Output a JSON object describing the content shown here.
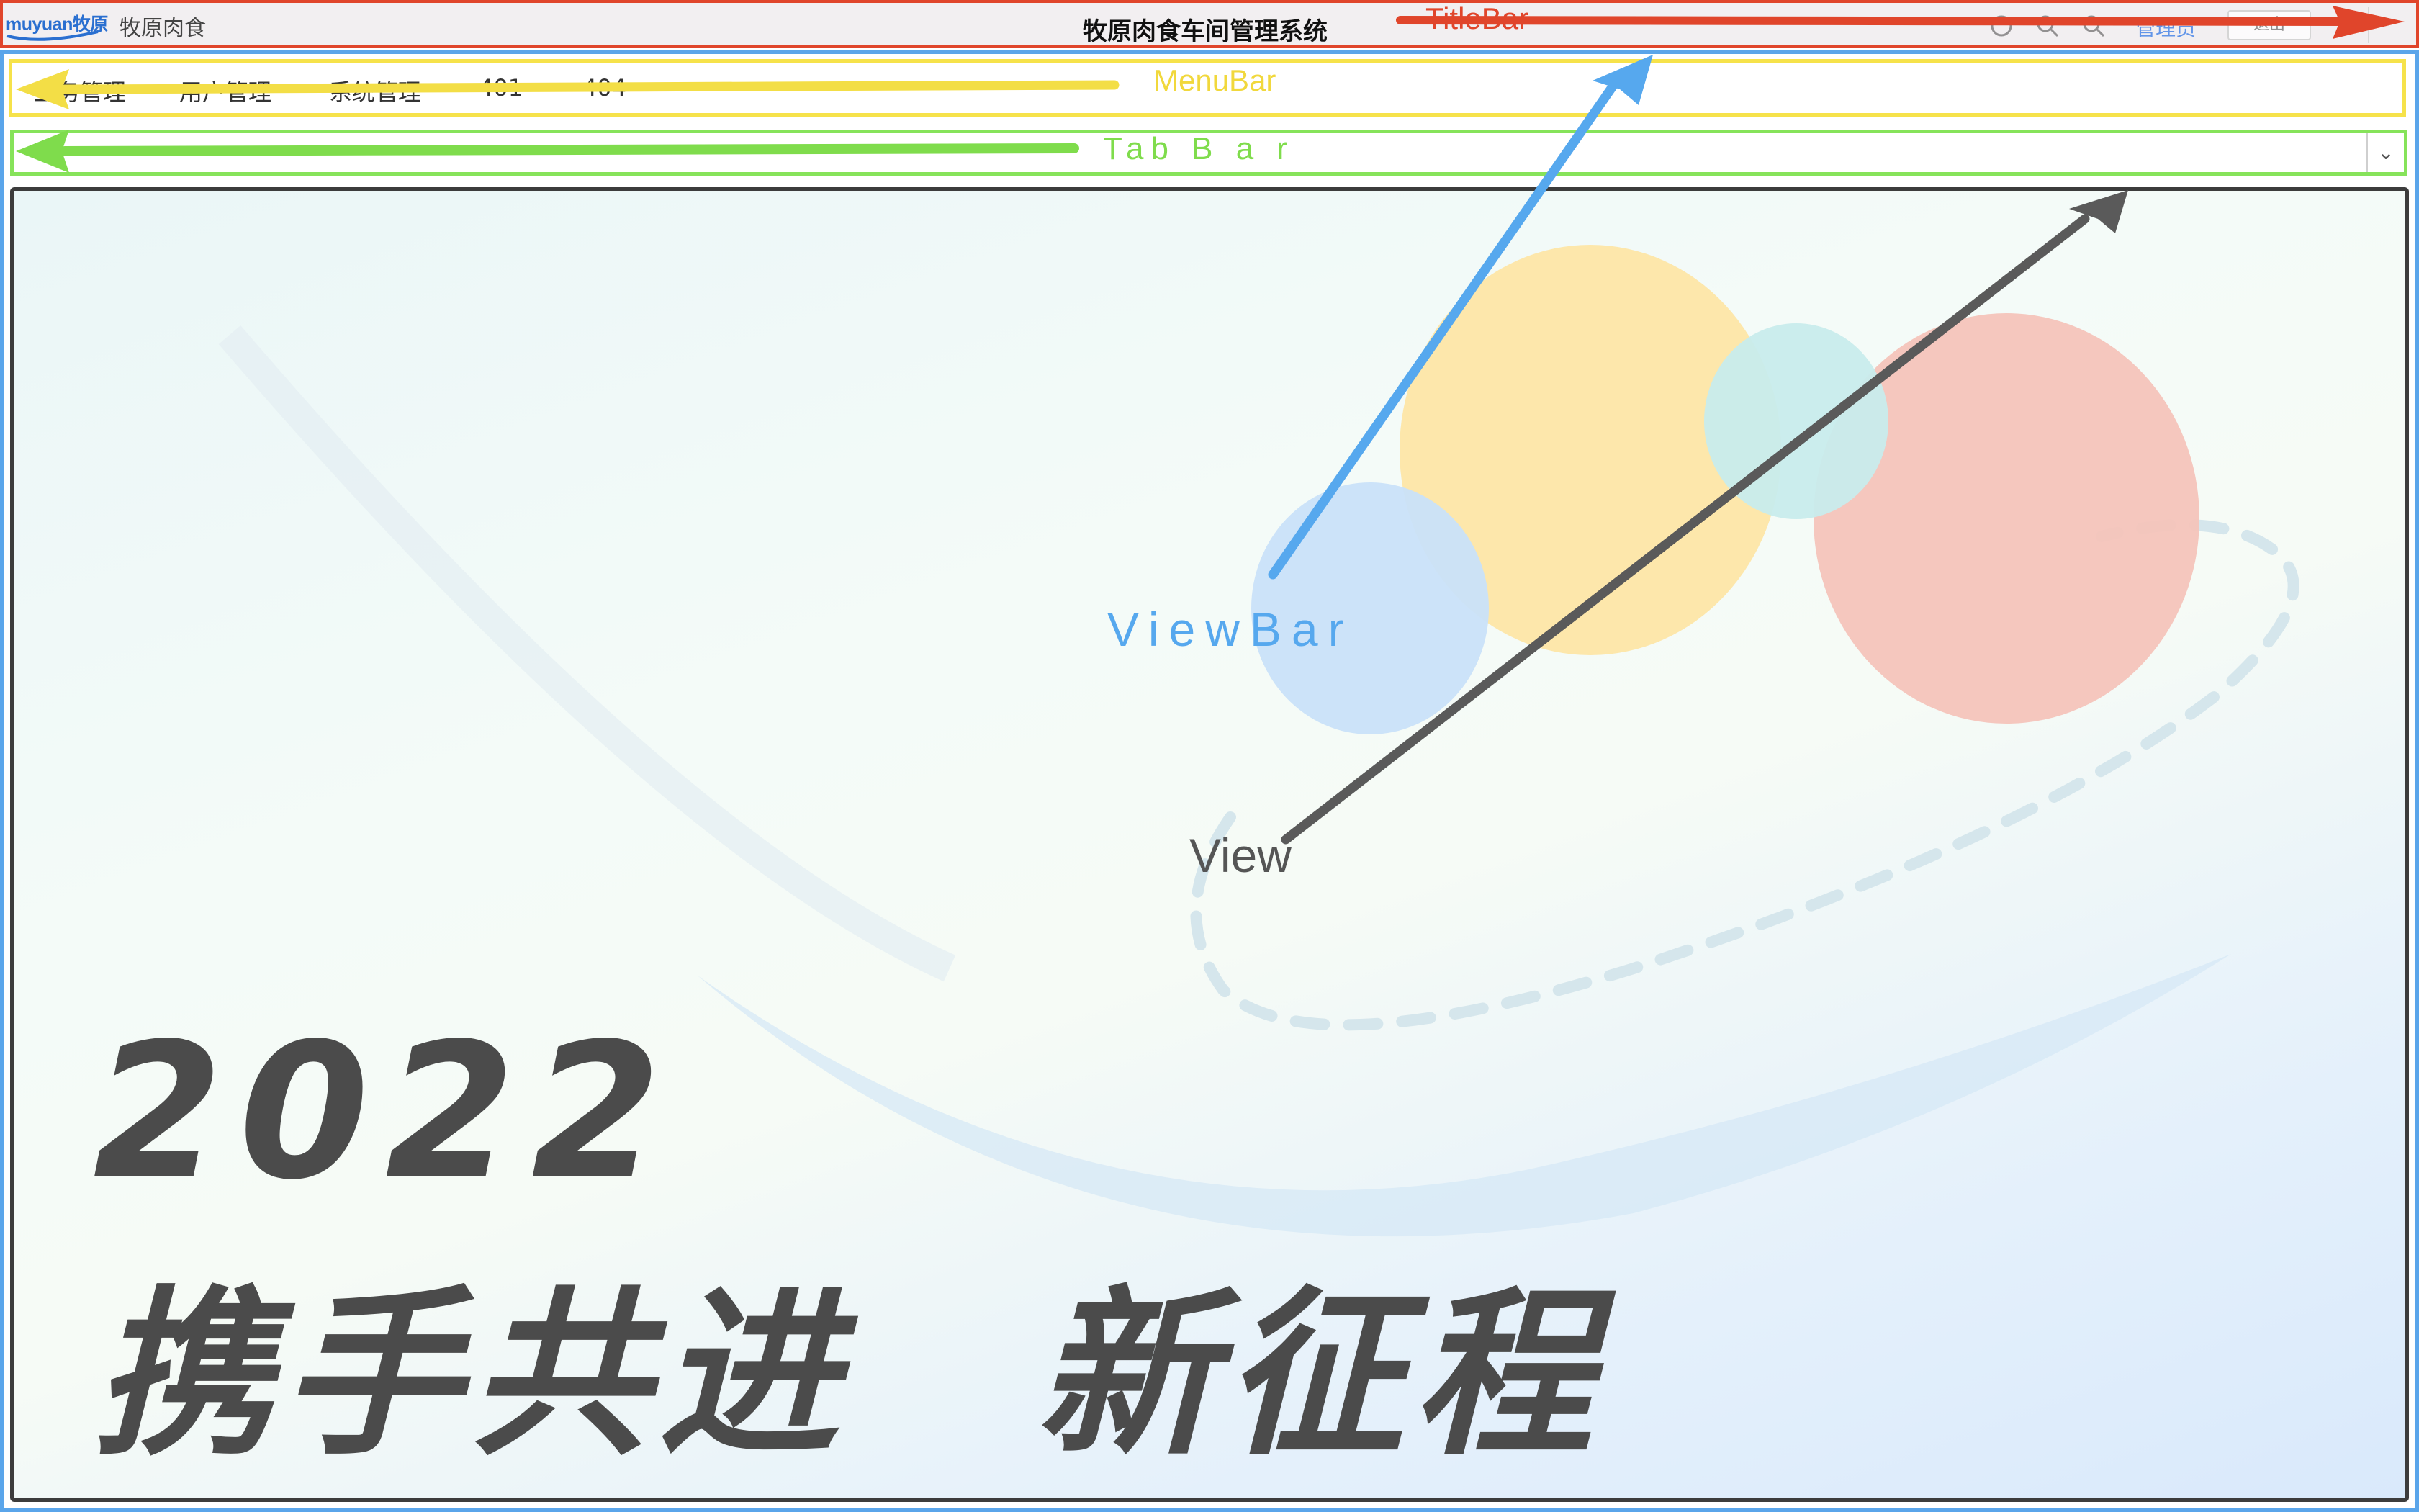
{
  "titlebar": {
    "logo_text": "muyuan牧原",
    "brand_name": "牧原肉食",
    "app_title": "牧原肉食车间管理系统",
    "user_label": "管理员",
    "action_button": "退出"
  },
  "menubar": {
    "items": [
      "业务管理",
      "用户管理",
      "系统管理",
      "401",
      "404"
    ]
  },
  "tabbar": {
    "dropdown_icon": "chevron-down-icon"
  },
  "view": {
    "headline_year": "2022",
    "headline_slogan": "携手共进　新征程"
  },
  "annotations": {
    "titlebar": "TitleBar",
    "menubar": "MenuBar",
    "tabbar": "Tab B a r",
    "viewbar": "ViewBar",
    "view": "View"
  },
  "colors": {
    "titlebar_border": "#e0452b",
    "menubar_border": "#f6e24a",
    "tabbar_border": "#86e35a",
    "viewbar_border": "#5aa5ea",
    "view_border": "#3c3c3c",
    "headline": "#4b4b4b"
  }
}
